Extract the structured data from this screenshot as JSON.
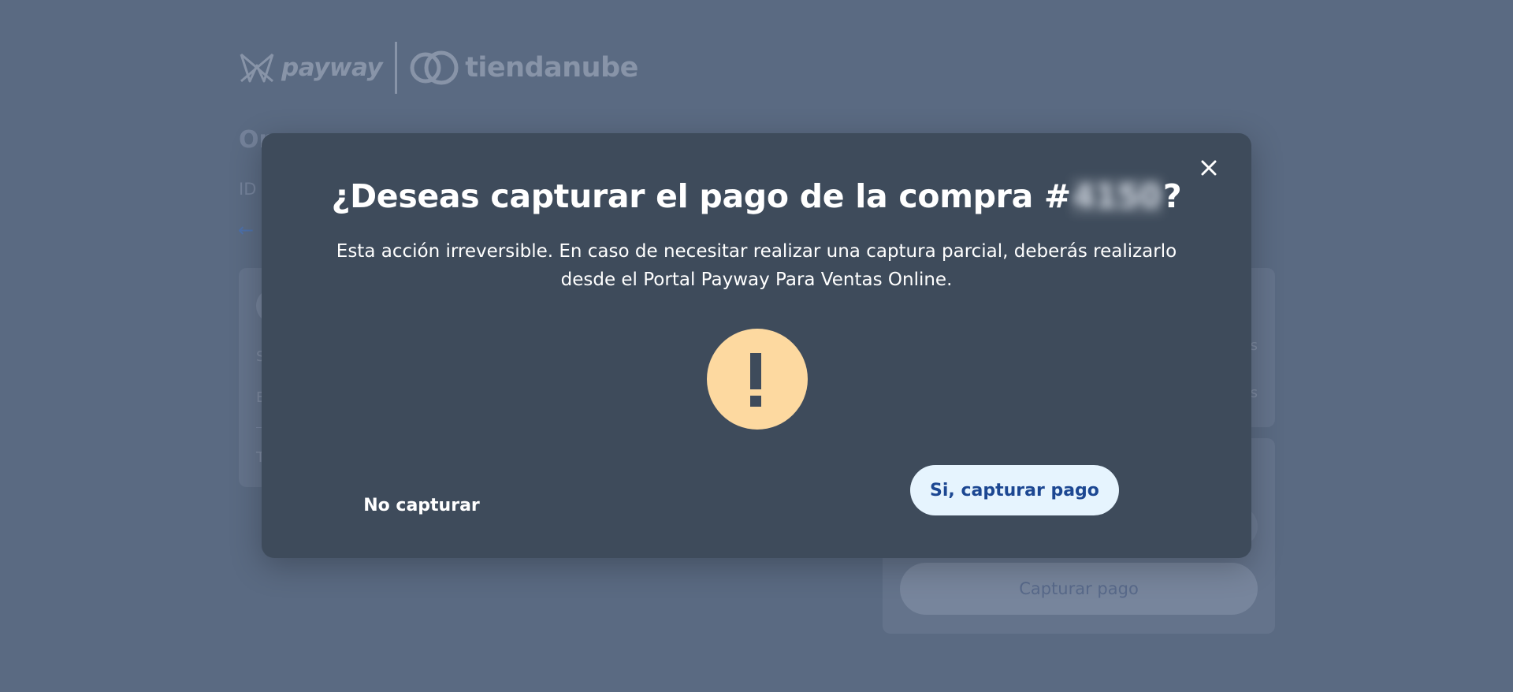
{
  "brand": {
    "payway_text": "payway",
    "tiendanube_text": "tiendanube"
  },
  "background": {
    "order_title": "Or",
    "id_label": "ID",
    "left_card_lines": [
      "S",
      "E",
      "T"
    ],
    "right_card_lines": [
      "s",
      "s"
    ],
    "capture_button_label": "Capturar pago"
  },
  "modal": {
    "title_prefix": "¿Deseas capturar el pago de la compra #",
    "order_number": "4150",
    "title_suffix": "?",
    "description": "Esta acción irreversible. En caso de necesitar realizar una captura parcial, deberás realizarlo desde el Portal Payway Para Ventas Online.",
    "alert_glyph": "!",
    "cancel_label": "No capturar",
    "confirm_label": "Si, capturar pago"
  },
  "icons": {
    "close": "close-icon",
    "alert": "exclamation-icon",
    "back": "arrow-left-icon"
  },
  "colors": {
    "overlay_bg": "#5a6a82",
    "modal_bg": "#3e4b5b",
    "alert_circle": "#fdd9a0",
    "confirm_bg": "#e6f4fe",
    "confirm_text": "#1c4792"
  }
}
